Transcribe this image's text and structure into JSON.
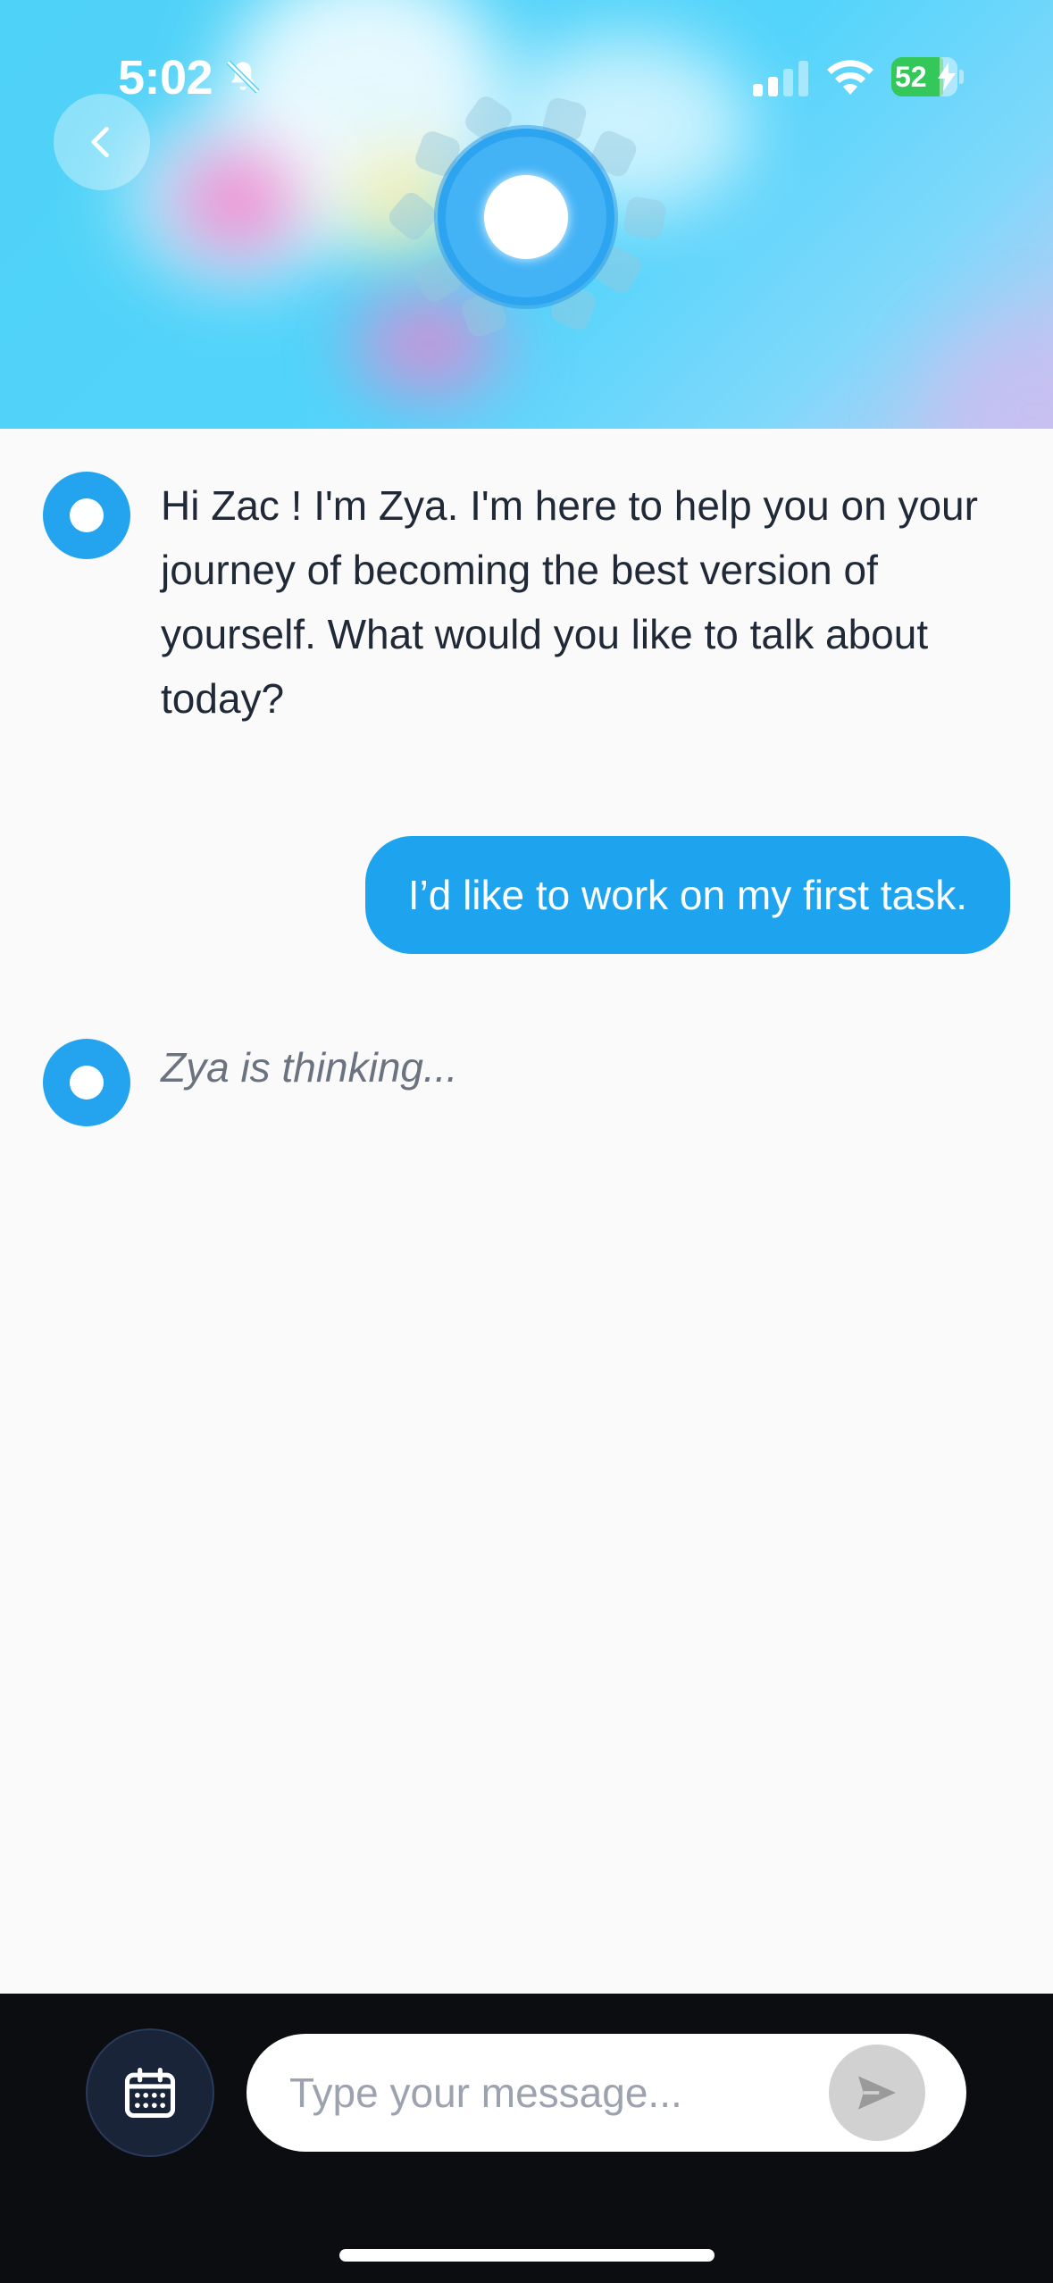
{
  "status_bar": {
    "time": "5:02",
    "battery_percent": "52",
    "battery_color": "#34c759",
    "icons": [
      "bell-slash-icon",
      "cellular-signal-icon",
      "wifi-icon",
      "battery-charging-icon"
    ]
  },
  "header": {
    "back_icon": "chevron-left-icon",
    "assistant_orb": "zya-orb-icon",
    "accent_color": "#24a4ef"
  },
  "chat": {
    "messages": [
      {
        "role": "assistant",
        "text": "Hi Zac ! I'm Zya. I'm here to help you on your journey of becoming the best version of yourself. What would you like to talk about today?"
      },
      {
        "role": "user",
        "text": "I’d like to work on my first task."
      }
    ],
    "thinking_text": "Zya is thinking..."
  },
  "composer": {
    "calendar_icon": "calendar-icon",
    "placeholder": "Type your message...",
    "value": "",
    "send_icon": "send-icon"
  }
}
